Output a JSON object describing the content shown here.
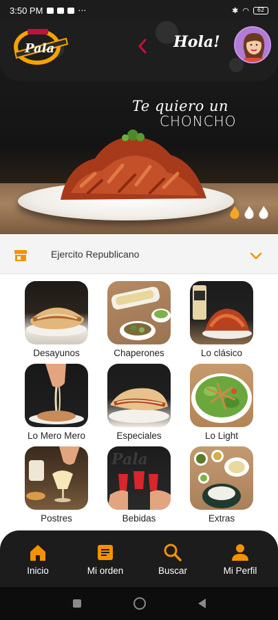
{
  "status_bar": {
    "time": "3:50 PM",
    "battery": "62"
  },
  "header": {
    "logo_text": "Pala",
    "greeting": "Hola!"
  },
  "hero": {
    "title_line1": "Te quiero un",
    "title_line2": "CHONCHO",
    "spice_level": "1 of 3 flames filled"
  },
  "location": {
    "name": "Ejercito Republicano"
  },
  "categories": [
    {
      "label": "Desayunos"
    },
    {
      "label": "Chaperones"
    },
    {
      "label": "Lo clásico"
    },
    {
      "label": "Lo Mero Mero"
    },
    {
      "label": "Especiales"
    },
    {
      "label": "Lo Light"
    },
    {
      "label": "Postres"
    },
    {
      "label": "Bebidas"
    },
    {
      "label": "Extras"
    }
  ],
  "bottom_nav": {
    "items": [
      {
        "label": "Inicio",
        "icon": "home-icon"
      },
      {
        "label": "Mi orden",
        "icon": "order-icon"
      },
      {
        "label": "Buscar",
        "icon": "search-icon"
      },
      {
        "label": "Mi Perfil",
        "icon": "profile-icon"
      }
    ]
  },
  "colors": {
    "accent": "#f39200",
    "dark": "#1c1c1c",
    "back_arrow": "#c0123a"
  }
}
